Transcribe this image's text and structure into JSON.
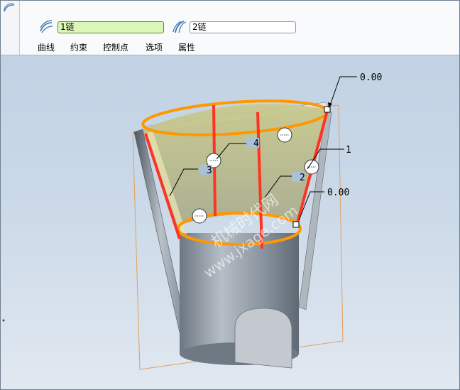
{
  "dashboard": {
    "collector_1": {
      "icon": "surface-boundary-icon",
      "value": "1链"
    },
    "collector_2": {
      "icon": "surface-boundary-icon",
      "value": "2链"
    },
    "tabs": [
      {
        "label": "曲线"
      },
      {
        "label": "约束"
      },
      {
        "label": "控制点"
      },
      {
        "label": "选项"
      },
      {
        "label": "属性"
      }
    ]
  },
  "graphics": {
    "dimension_top": "0.00",
    "dimension_right": "0.00",
    "curve_labels": [
      "1",
      "2",
      "3",
      "4"
    ],
    "watermark_line1": "机械时代网",
    "watermark_line2": "www.jxage.com",
    "colors": {
      "boundary_orange": "#ff9800",
      "control_red": "#ff3322",
      "surface_yellow": "#c8c98a",
      "body_gray": "#8e98a2",
      "frame_orange": "#e8a060"
    }
  }
}
